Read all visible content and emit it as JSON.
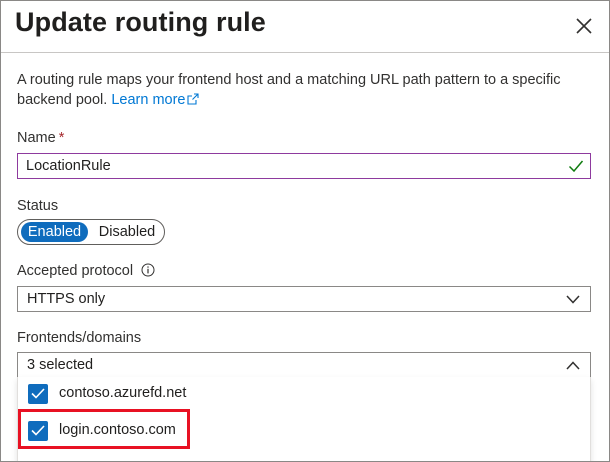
{
  "header": {
    "title": "Update routing rule"
  },
  "description": {
    "text": "A routing rule maps your frontend host and a matching URL path pattern to a specific backend pool.",
    "link_label": "Learn more"
  },
  "name_field": {
    "label": "Name",
    "required_mark": "*",
    "value": "LocationRule",
    "valid": true
  },
  "status": {
    "label": "Status",
    "options": [
      "Enabled",
      "Disabled"
    ],
    "selected": "Enabled"
  },
  "accepted_protocol": {
    "label": "Accepted protocol",
    "value": "HTTPS only"
  },
  "frontends": {
    "label": "Frontends/domains",
    "value": "3 selected",
    "options": [
      {
        "label": "contoso.azurefd.net",
        "checked": true
      },
      {
        "label": "login.contoso.com",
        "checked": true
      }
    ]
  },
  "colors": {
    "accent": "#0f6cbd",
    "link": "#0078d4",
    "focus_border": "#8e3a9e",
    "valid_check": "#107c10",
    "highlight": "#e81123"
  },
  "icons": [
    "close-icon",
    "external-link-icon",
    "checkmark-icon",
    "info-icon",
    "chevron-down-icon",
    "chevron-up-icon",
    "checkbox-checked-icon"
  ]
}
